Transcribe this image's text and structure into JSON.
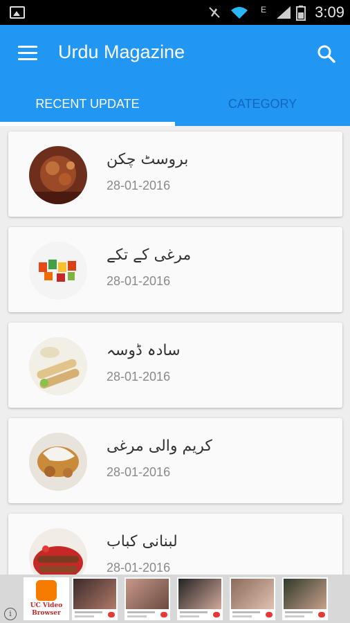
{
  "status_bar": {
    "time": "3:09",
    "network": "E"
  },
  "app_bar": {
    "title": "Urdu Magazine"
  },
  "tabs": [
    {
      "label": "RECENT UPDATE",
      "selected": true
    },
    {
      "label": "CATEGORY",
      "selected": false
    }
  ],
  "items": [
    {
      "title": "بروسٹ چکن",
      "date": "28-01-2016"
    },
    {
      "title": "مرغی کے تکے",
      "date": "28-01-2016"
    },
    {
      "title": "سادہ ڈوسہ",
      "date": "28-01-2016"
    },
    {
      "title": "کریم والی مرغی",
      "date": "28-01-2016"
    },
    {
      "title": "لبنانی کباب",
      "date": "28-01-2016"
    }
  ],
  "ad": {
    "app_name": "UC Video\nBrowser"
  },
  "colors": {
    "primary": "#2196f3",
    "tab_inactive": "#1565c0"
  }
}
